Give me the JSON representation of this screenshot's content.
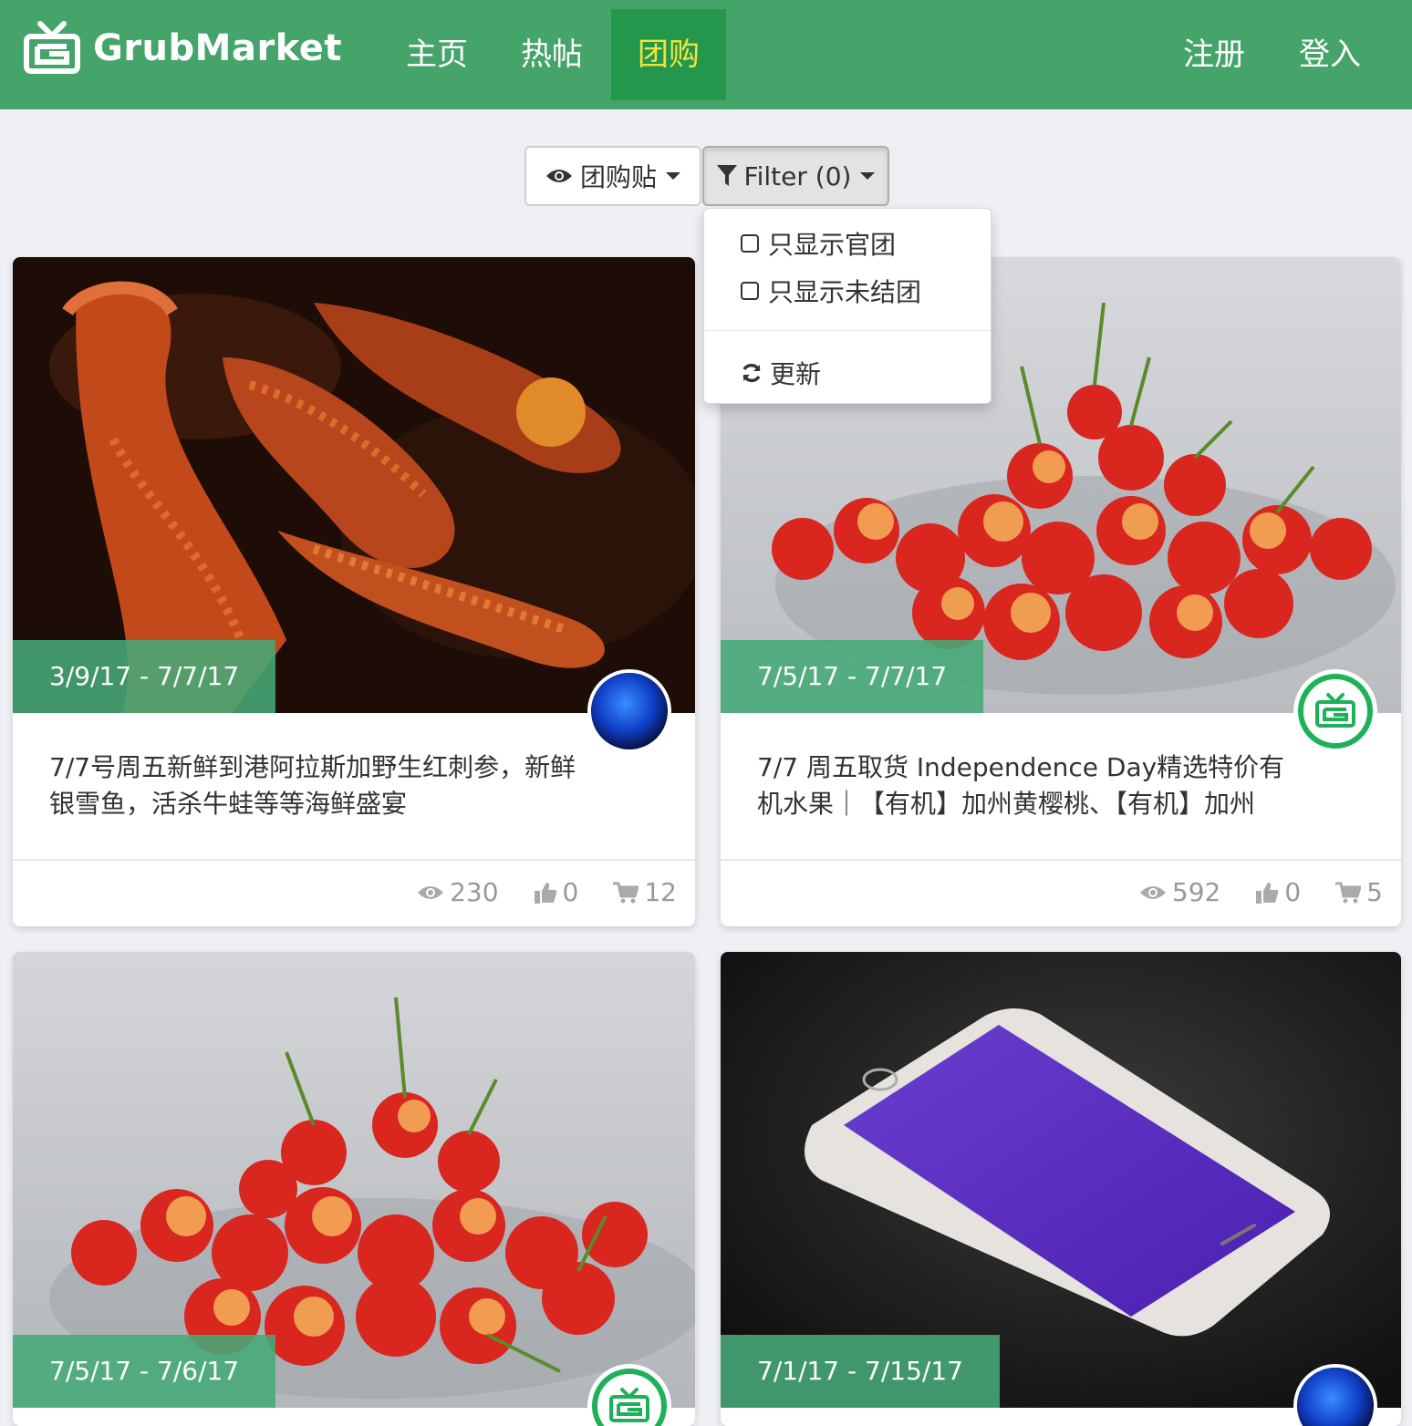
{
  "navbar": {
    "brand": "GrubMarket",
    "links": [
      "主页",
      "热帖",
      "团购"
    ],
    "active": "团购",
    "right": [
      "注册",
      "登入"
    ]
  },
  "toolbar": {
    "view_label": "团购贴",
    "view_icon": "eye-icon",
    "filter_label": "Filter (0)",
    "filter_icon": "filter-icon"
  },
  "dropdown": {
    "options": [
      "只显示官团",
      "只显示未结团"
    ],
    "refresh_label": "更新",
    "refresh_icon": "refresh-icon"
  },
  "cards": [
    {
      "date": "3/9/17 - 7/7/17",
      "title": "7/7号周五新鲜到港阿拉斯加野生红刺参，新鲜银雪鱼，活杀牛蛙等等海鲜盛宴",
      "views": "230",
      "likes": "0",
      "comments": "12",
      "image": "sea-cucumber-photo",
      "avatar": "blue-avatar"
    },
    {
      "date": "7/5/17 - 7/7/17",
      "title": "7/7 周五取货 Independence Day精选特价有机水果｜【有机】加州黄樱桃、【有机】加州",
      "views": "592",
      "likes": "0",
      "comments": "5",
      "image": "cherries-photo",
      "avatar": "grubmarket-avatar"
    },
    {
      "date": "7/5/17 - 7/6/17",
      "image": "cherries-photo",
      "avatar": "grubmarket-avatar"
    },
    {
      "date": "7/1/17 - 7/15/17",
      "image": "smartphone-photo",
      "avatar": "blue-avatar"
    }
  ],
  "colors": {
    "nav_bg": "#45a46a",
    "nav_active_bg": "#23984d",
    "nav_active_text": "#f4e33b",
    "tag_bg": "#45aa78"
  }
}
